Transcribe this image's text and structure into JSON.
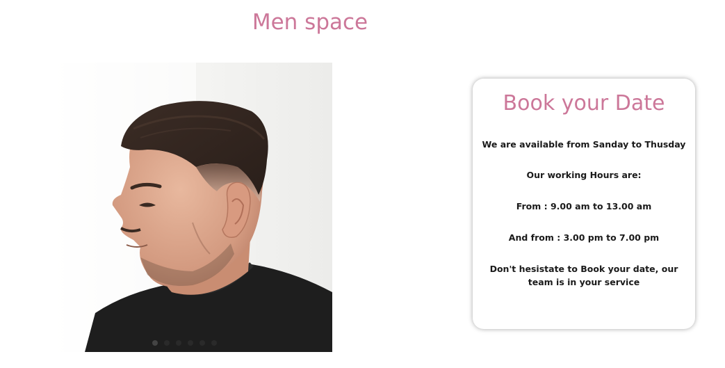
{
  "page": {
    "title": "Men space"
  },
  "carousel": {
    "image_alt": "man haircut side profile",
    "dot_count": 6,
    "active_index": 0
  },
  "booking": {
    "title": "Book your Date",
    "availability": "We are available from Sanday to Thusday",
    "hours_heading": "Our working Hours are:",
    "morning_hours": "From : 9.00 am to 13.00 am",
    "afternoon_hours": "And from : 3.00 pm to 7.00 pm",
    "cta": "Don't hesistate to Book your date, our team is in your service"
  },
  "colors": {
    "accent": "#cc7799",
    "text": "#1a1a1a",
    "background": "#ffffff"
  }
}
